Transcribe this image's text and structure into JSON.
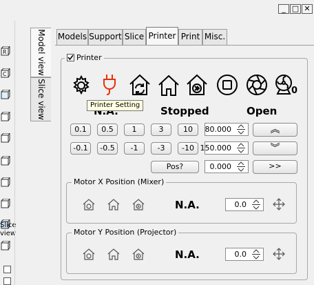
{
  "window": {
    "minimize_glyph": "_",
    "maximize_glyph": "□",
    "close_glyph": "✕"
  },
  "left_toolbar": {
    "items": [
      "box-icon",
      "box-icon",
      "box-icon",
      "box-icon",
      "box-icon",
      "box-icon",
      "box-icon",
      "box-icon",
      "box-icon",
      "box-icon",
      "box-icon"
    ],
    "slice_view_label_1": "Slice",
    "slice_view_label_2": "view"
  },
  "vertical_tabs": [
    {
      "label": "Model view",
      "active": true
    },
    {
      "label": "Slice view",
      "active": false
    }
  ],
  "tabs": [
    {
      "label": "Models"
    },
    {
      "label": "Support"
    },
    {
      "label": "Slice"
    },
    {
      "label": "Printer",
      "active": true
    },
    {
      "label": "Print"
    },
    {
      "label": "Misc."
    }
  ],
  "printer": {
    "checkbox_label": "Printer",
    "checked": true,
    "icons": [
      "printer-setting-icon",
      "plug-icon",
      "home-refresh-icon",
      "home-icon",
      "home-forward-icon",
      "stop-icon",
      "shutter-icon",
      "fan-icon"
    ],
    "fan_count": "0",
    "tooltip": "Printer Setting",
    "status_left": "N.A.",
    "status_mid": "Stopped",
    "status_right": "Open",
    "row1": [
      "0.1",
      "0.5",
      "1",
      "3",
      "10"
    ],
    "row2": [
      "-0.1",
      "-0.5",
      "-1",
      "-3",
      "-10"
    ],
    "spin1": "80.000",
    "spin2": "150.000",
    "pos_button": "Pos?",
    "spin3": "0.000",
    "up_glyph": "︽",
    "down_glyph": "︾",
    "forward_button": ">>"
  },
  "motor_x": {
    "title": "Motor X Position (Mixer)",
    "status": "N.A.",
    "value": "0.0"
  },
  "motor_y": {
    "title": "Motor Y Position (Projector)",
    "status": "N.A.",
    "value": "0.0"
  }
}
